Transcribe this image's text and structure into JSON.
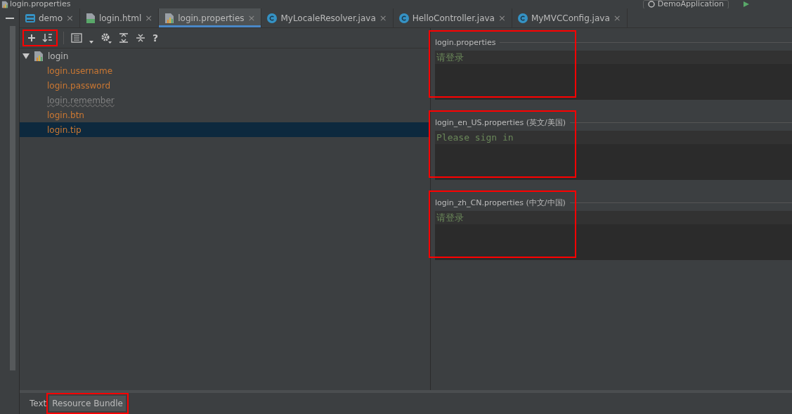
{
  "breadcrumb": {
    "label": "login.properties"
  },
  "run_config": {
    "label": "DemoApplication"
  },
  "tabs": [
    {
      "label": "demo",
      "kind": "module",
      "selected": false
    },
    {
      "label": "login.html",
      "kind": "html",
      "selected": false
    },
    {
      "label": "login.properties",
      "kind": "properties",
      "selected": true
    },
    {
      "label": "MyLocaleResolver.java",
      "kind": "class",
      "selected": false
    },
    {
      "label": "HelloController.java",
      "kind": "class",
      "selected": false
    },
    {
      "label": "MyMVCConfig.java",
      "kind": "class",
      "selected": false
    }
  ],
  "toolbar": {
    "highlighted": true,
    "help_label": "?",
    "close_label": "×"
  },
  "tree": {
    "label": "login",
    "expanded": true,
    "children": [
      {
        "label": "login.username",
        "unused": false,
        "selected": false
      },
      {
        "label": "login.password",
        "unused": false,
        "selected": false
      },
      {
        "label": "login.remember",
        "unused": true,
        "selected": false
      },
      {
        "label": "login.btn",
        "unused": false,
        "selected": false
      },
      {
        "label": "login.tip",
        "unused": false,
        "selected": true
      }
    ]
  },
  "locales": [
    {
      "title": "login.properties",
      "value": "请登录",
      "highlighted": true
    },
    {
      "title": "login_en_US.properties (英文/美国)",
      "value": "Please sign in",
      "highlighted": true
    },
    {
      "title": "login_zh_CN.properties (中文/中国)",
      "value": "请登录",
      "highlighted": true
    }
  ],
  "bottom_tabs": [
    {
      "label": "Text",
      "selected": false,
      "highlighted": false
    },
    {
      "label": "Resource Bundle",
      "selected": true,
      "highlighted": true
    }
  ]
}
